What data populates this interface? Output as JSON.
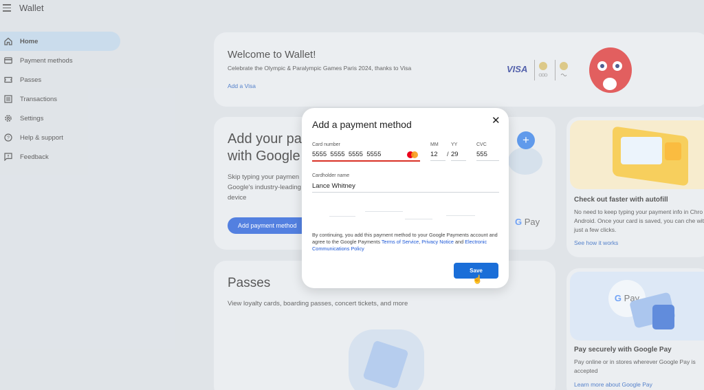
{
  "app": {
    "title": "Wallet"
  },
  "sidebar": {
    "items": [
      {
        "label": "Home",
        "icon": "home-icon",
        "active": true
      },
      {
        "label": "Payment methods",
        "icon": "credit-card-icon",
        "active": false
      },
      {
        "label": "Passes",
        "icon": "ticket-icon",
        "active": false
      },
      {
        "label": "Transactions",
        "icon": "list-icon",
        "active": false
      },
      {
        "label": "Settings",
        "icon": "gear-icon",
        "active": false
      },
      {
        "label": "Help & support",
        "icon": "help-icon",
        "active": false
      },
      {
        "label": "Feedback",
        "icon": "feedback-icon",
        "active": false
      }
    ]
  },
  "welcome": {
    "title": "Welcome to Wallet!",
    "subtitle": "Celebrate the Olympic & Paralympic Games Paris 2024, thanks to Visa",
    "link": "Add a Visa",
    "visa_logo": "VISA"
  },
  "add_card": {
    "title": "Add your pa with Google",
    "description": "Skip typing your paymen Google's industry-leading device",
    "button": "Add payment method",
    "gpay_logo": "G Pay"
  },
  "autofill": {
    "title": "Check out faster with autofill",
    "body": "No need to keep typing your payment info in Chro or Android. Once your card is saved, you can che with just a few clicks.",
    "link": "See how it works"
  },
  "gpay_card": {
    "logo": "G Pay",
    "title": "Pay securely with Google Pay",
    "body": "Pay online or in stores wherever Google Pay is accepted",
    "link": "Learn more about Google Pay"
  },
  "passes": {
    "title": "Passes",
    "description": "View loyalty cards, boarding passes, concert tickets, and more"
  },
  "dialog": {
    "title": "Add a payment method",
    "card_number_label": "Card number",
    "card_number_value": "5555  5555  5555  5555",
    "mm_label": "MM",
    "mm_value": "12",
    "yy_label": "YY",
    "yy_value": "29",
    "cvc_label": "CVC",
    "cvc_value": "555",
    "holder_label": "Cardholder name",
    "holder_value": "Lance Whitney",
    "legal_prefix": "By continuing, you add this payment method to your Google Payments account and agree to the Google Payments ",
    "terms_link": "Terms of Service",
    "sep": ", ",
    "privacy_link": "Privacy Notice",
    "and_text": " and ",
    "ecp_link": "Electronic Communications Policy",
    "save_label": "Save",
    "close_icon": "close-icon",
    "card_brand_icon": "mastercard-icon"
  },
  "colors": {
    "primary": "#1a56d6",
    "error": "#d93025",
    "active_nav": "#b9d1e6"
  }
}
